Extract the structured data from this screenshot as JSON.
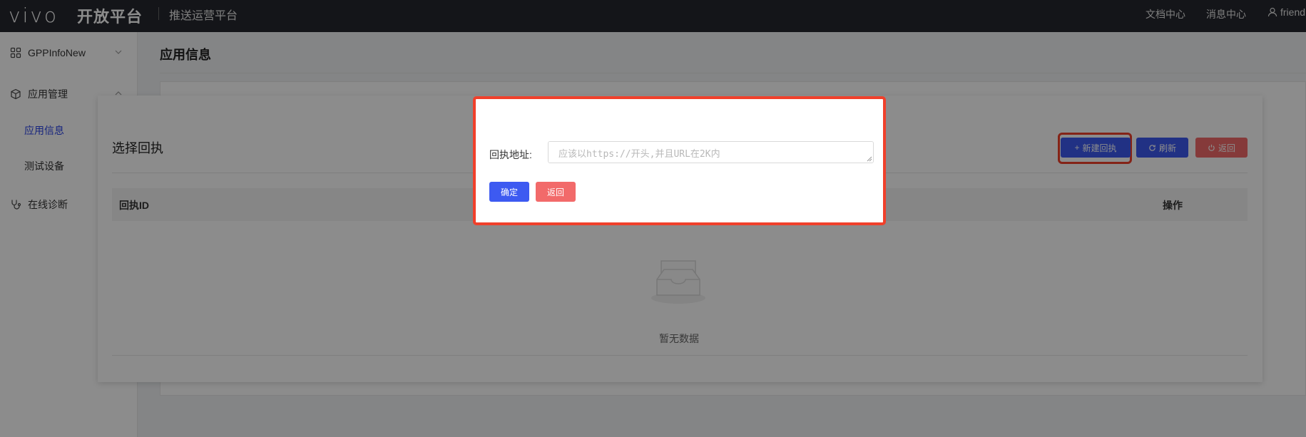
{
  "topbar": {
    "logo": "vivo",
    "brand": "开放平台",
    "subtitle": "推送运营平台",
    "links": [
      "文档中心",
      "消息中心"
    ],
    "user": "friend"
  },
  "sidebar": {
    "app_selector": "GPPInfoNew",
    "items": [
      {
        "label": "应用管理",
        "icon": "cube-icon"
      },
      {
        "label": "应用信息",
        "active": true
      },
      {
        "label": "测试设备"
      },
      {
        "label": "在线诊断",
        "icon": "stethoscope-icon"
      }
    ]
  },
  "main": {
    "page_title": "应用信息"
  },
  "panel": {
    "title": "选择回执",
    "buttons": {
      "new": "新建回执",
      "refresh": "刷新",
      "back": "返回"
    },
    "columns": [
      "回执ID",
      "操作"
    ],
    "empty_text": "暂无数据"
  },
  "dialog": {
    "label": "回执地址:",
    "placeholder": "应该以https://开头,并且URL在2K内",
    "confirm": "确定",
    "back": "返回"
  },
  "colors": {
    "primary": "#3d5af1",
    "danger": "#f26a6a",
    "highlight": "#f0402b",
    "topbar": "#25272e"
  }
}
